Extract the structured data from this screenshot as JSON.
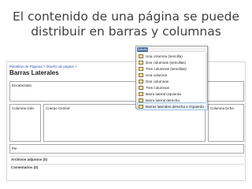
{
  "slide": {
    "title_line1": "El contenido de una página se puede",
    "title_line2": "distribuir en barras y columnas"
  },
  "page": {
    "breadcrumb": "Plantillas de Páginas > Diseño de página >",
    "heading": "Barras Laterales"
  },
  "sections": {
    "header": "Encabezado",
    "left_column": "Columna Izda",
    "center": "Cuerpo Central",
    "right_column": "Columna Dcha",
    "footer": "Pie"
  },
  "links": {
    "attachments": "Archivos adjuntos (0)",
    "comments": "Comentarios (0)"
  },
  "menu": {
    "tab": "Diseño",
    "items": [
      "Una columna (sencilla)",
      "Dos columnas (sencillas)",
      "Tres columnas (sencillas)",
      "Una columna",
      "Dos columnas",
      "Tres columnas",
      "Barra lateral izquierda",
      "Barra lateral derecha",
      "Barras laterales derecha e izquierda"
    ],
    "selected_index": 8
  }
}
